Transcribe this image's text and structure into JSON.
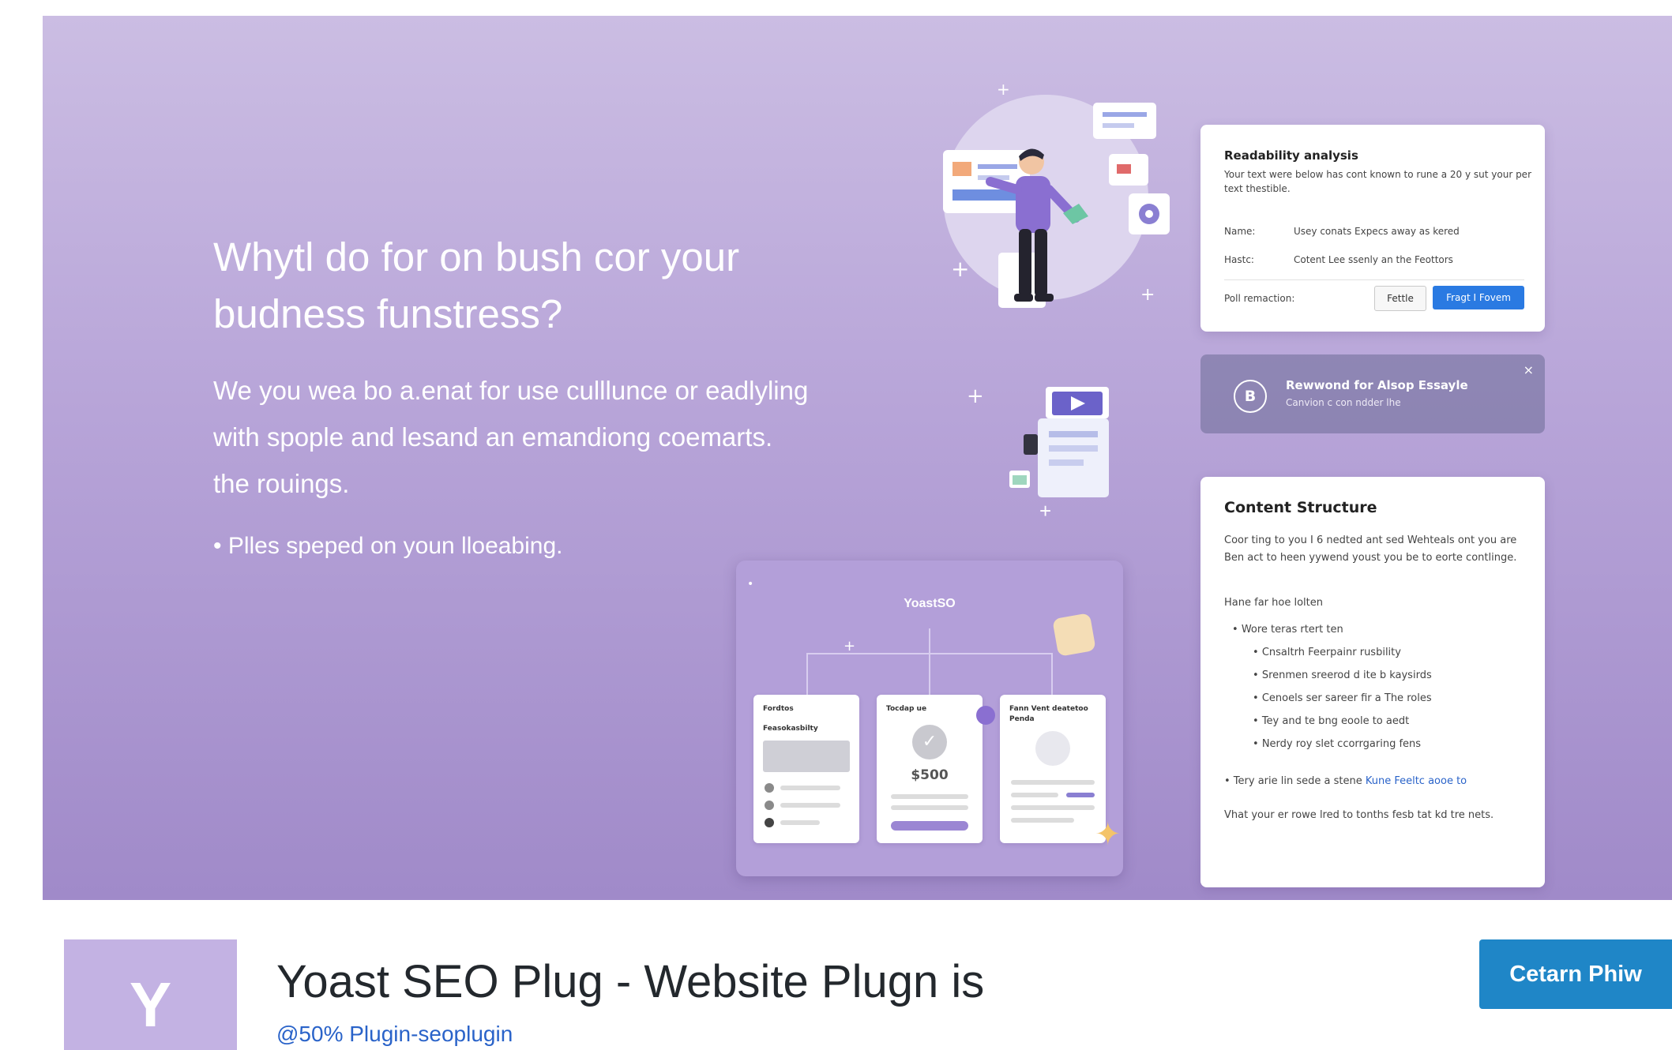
{
  "banner": {
    "headline_line1": "Whytl do for  on bush cor your",
    "headline_line2": "budness funstress?",
    "body_line1": "We you wea bo a.enat for use culllunce or eadlyling",
    "body_line2": "with spople and lesand an emandiong coemarts.",
    "body_line3": "the rouings.",
    "bullet": "• Plles speped on youn lloeabing."
  },
  "readability_card": {
    "title": "Readability analysis",
    "description": "Your text were below has cont known to rune a 20 y sut your per text thestible.",
    "rows": [
      {
        "label": "Name:",
        "value": "Usey conats Expecs away as kered"
      },
      {
        "label": "Hastc:",
        "value": "Cotent Lee ssenly an the Feottors"
      }
    ],
    "footer_label": "Poll remaction:",
    "secondary_button": "Fettle",
    "primary_button": "Fragt I Fovem"
  },
  "notice": {
    "badge": "B",
    "title": "Rewwond for Alsop Essayle",
    "subtitle": "Canvion c con ndder lhe",
    "close": "×"
  },
  "content_card": {
    "title": "Content Structure",
    "description": "Coor ting to you I 6 nedted ant sed Wehteals ont you are Ben act to heen yywend youst you be to eorte contlinge.",
    "heading": "Hane far hoe lolten",
    "items": [
      {
        "text": "Wore teras rtert ten",
        "level": 0
      },
      {
        "text": "Cnsaltrh Feerpainr rusbility",
        "level": 1
      },
      {
        "text": "Srenmen sreerod d ite b kaysirds",
        "level": 1
      },
      {
        "text": "Cenoels ser sareer fir a The roles",
        "level": 1
      },
      {
        "text": "Tey and te bng eoole to aedt",
        "level": 1
      },
      {
        "text": "Nerdy roy slet ccorrgaring fens",
        "level": 1
      }
    ],
    "link_prefix": "• Tery arie lin sede a stene ",
    "link_text": "Kune Feeltc aooe to",
    "footer": "Vhat your er rowe lred to tonths fesb tat kd tre nets."
  },
  "dashboard": {
    "brand": "YoastSO",
    "card1_title": "Fordtos",
    "card1_subtitle": "Feasokasbilty",
    "card2_title": "Tocdap ue",
    "card2_price": "$500",
    "card3_title": "Fann Vent deatetoo Penda"
  },
  "plugin": {
    "logo_letter": "Y",
    "title": "Yoast SEO Plug - Website Plugn is",
    "subtitle": "@50% Plugin-seoplugin",
    "action_button": "Cetarn Phiw"
  },
  "colors": {
    "banner_top": "#cbbde3",
    "banner_bottom": "#a08ac9",
    "action_blue": "#1f86c7",
    "primary_blue": "#2a7ae2",
    "logo_bg": "#c3b2e3"
  }
}
